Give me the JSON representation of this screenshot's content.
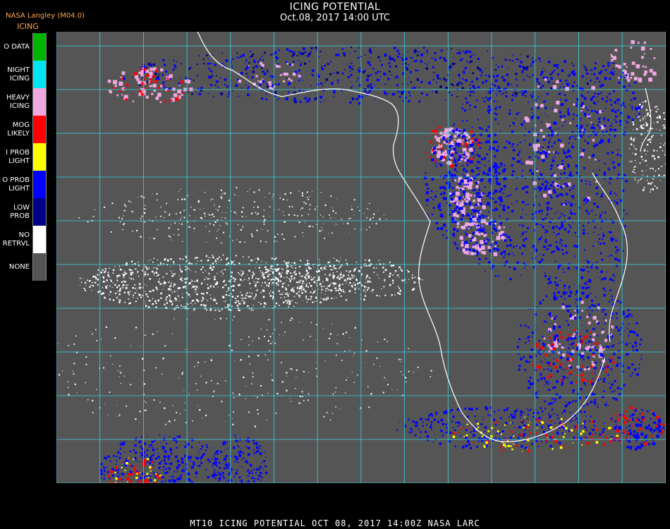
{
  "header": {
    "title": "ICING POTENTIAL",
    "subtitle": "Oct.08, 2017 14:00 UTC",
    "org": "NASA Langley (M04.0)",
    "product": "ICING"
  },
  "legend": [
    {
      "label": "O DATA",
      "color": "#00b400"
    },
    {
      "label": "NIGHT\nICING",
      "color": "#00e5f0"
    },
    {
      "label": "HEAVY\nICING",
      "color": "#f0a8e0"
    },
    {
      "label": "MOG\nLIKELY",
      "color": "#ff0000"
    },
    {
      "label": "I PROB\nLIGHT",
      "color": "#ffff00"
    },
    {
      "label": "O PROB\nLIGHT",
      "color": "#0000ff"
    },
    {
      "label": "LOW\nPROB",
      "color": "#000088"
    },
    {
      "label": "NO\nRETRVL",
      "color": "#ffffff"
    },
    {
      "label": "NONE",
      "color": "#555555"
    }
  ],
  "colors": {
    "background": "#555555",
    "grid": "#33d6e6",
    "coastline": "#ffffff",
    "grid_label": "#cc2222"
  },
  "footer": "MT10  ICING POTENTIAL   OCT 08, 2017 14:00Z   NASA LARC"
}
